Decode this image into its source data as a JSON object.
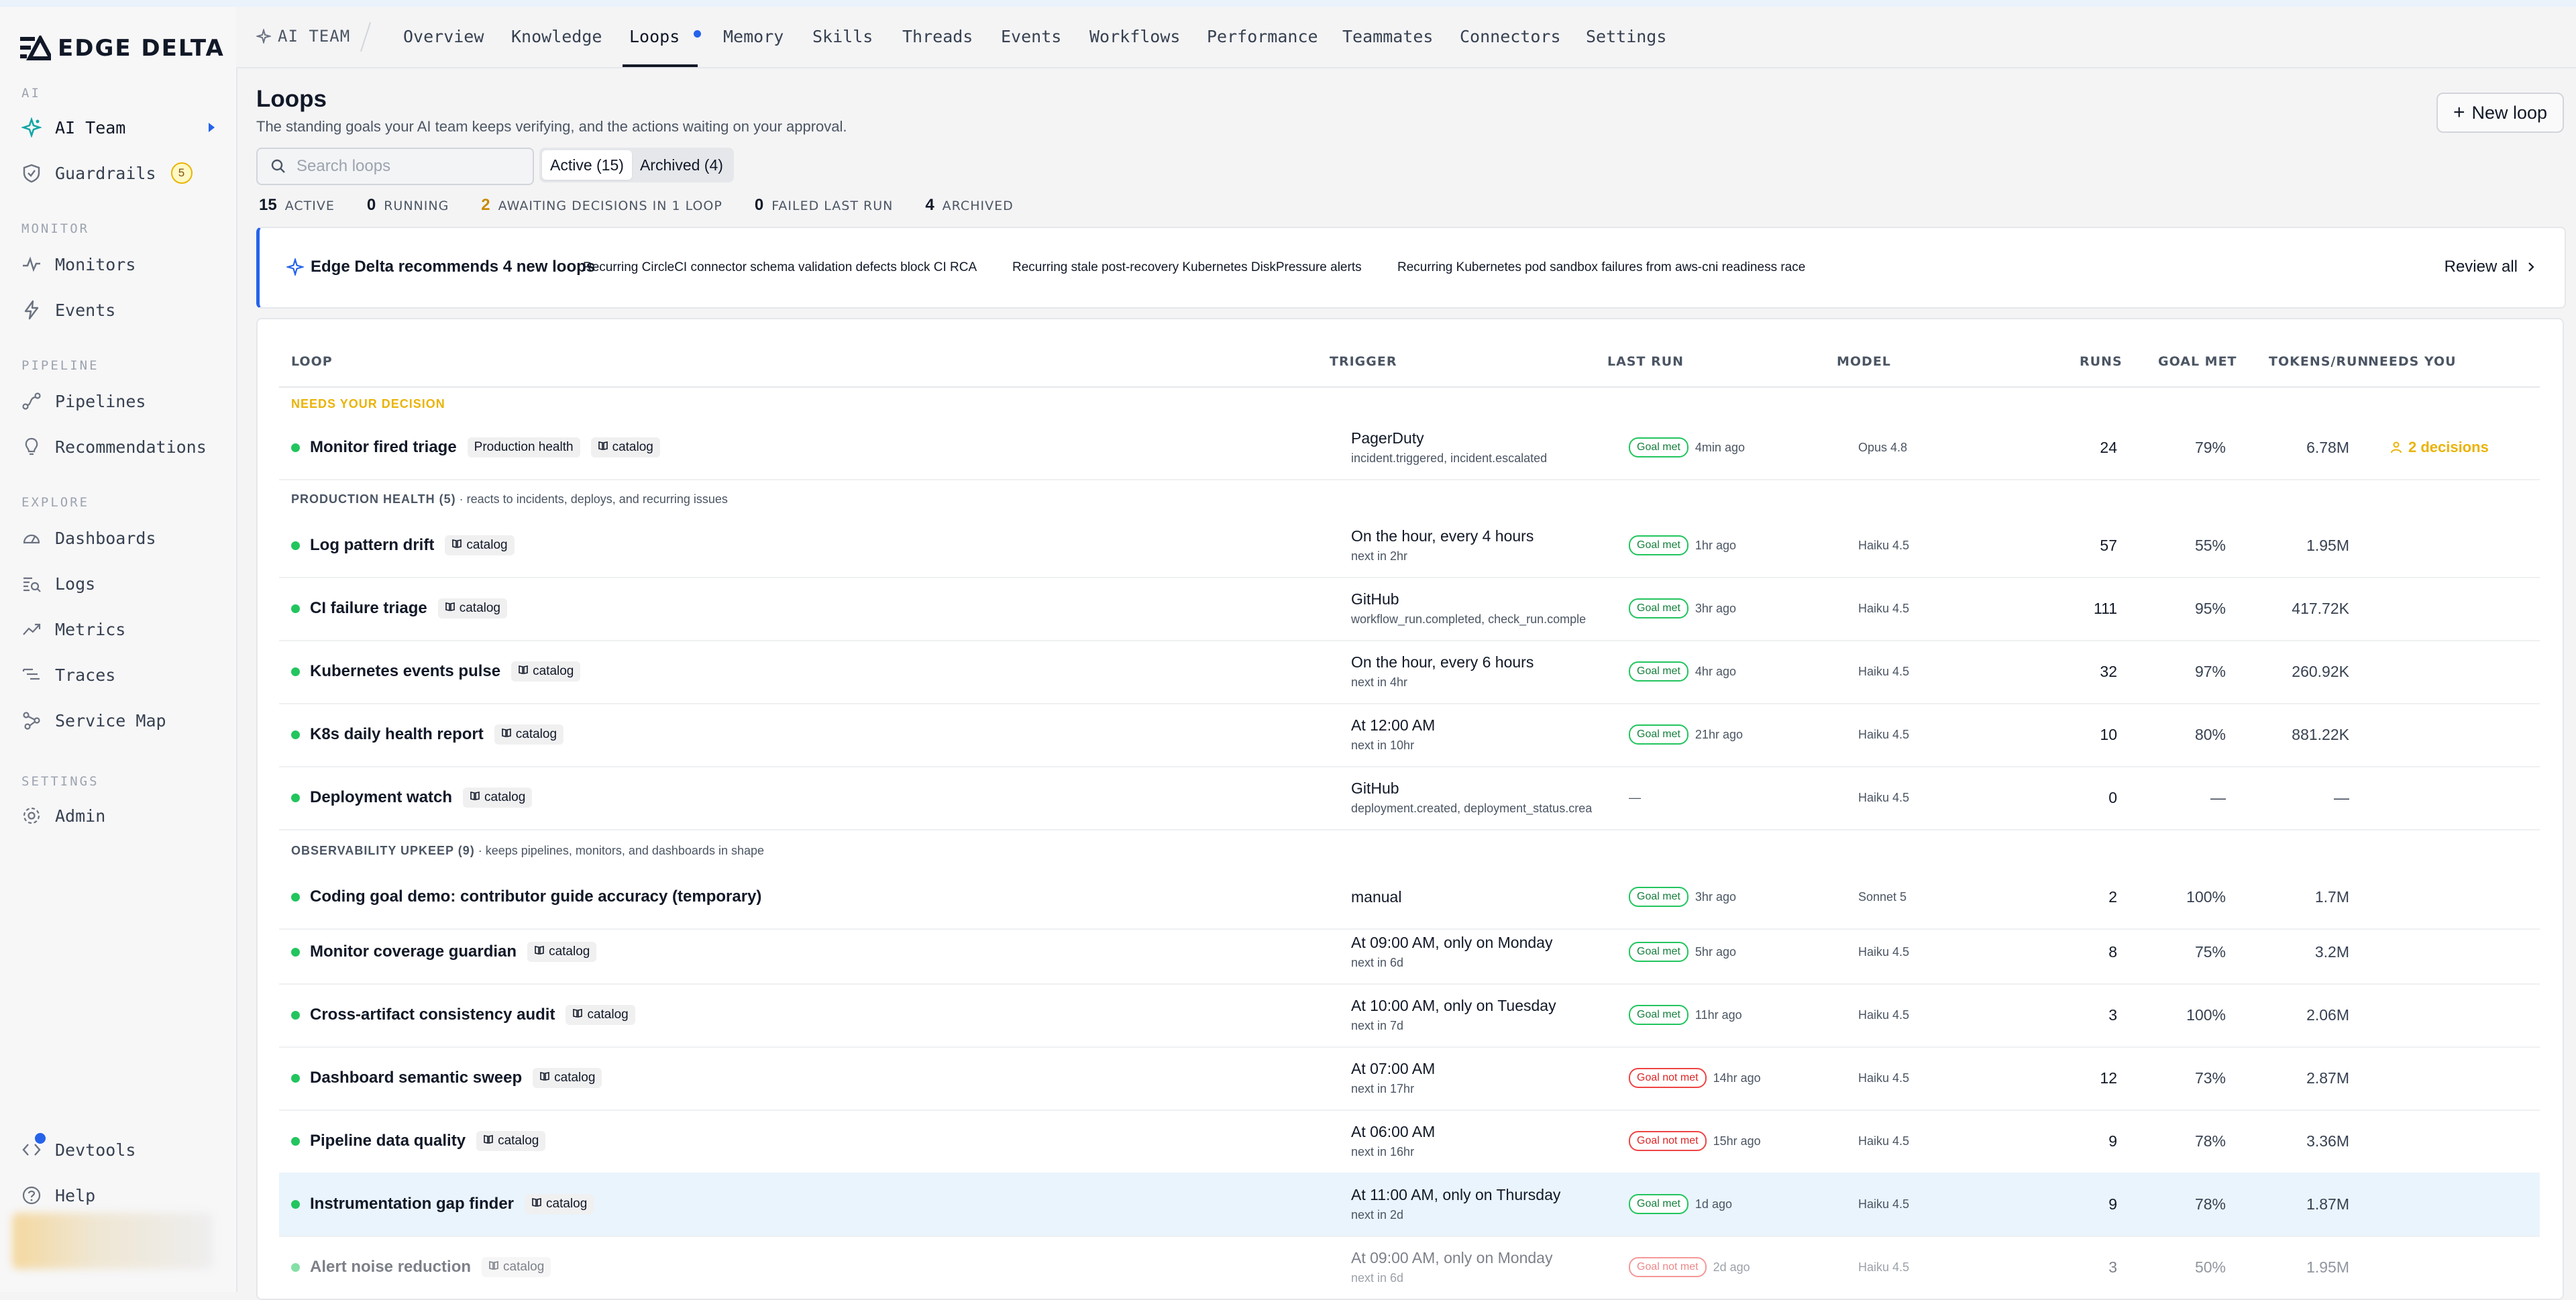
{
  "app": {
    "logo_text": "EDGE DELTA"
  },
  "sidebar": {
    "sections": {
      "ai": "AI",
      "monitor": "MONITOR",
      "pipeline": "PIPELINE",
      "explore": "EXPLORE",
      "settings": "SETTINGS"
    },
    "items": {
      "ai_team": "AI Team",
      "guardrails": "Guardrails",
      "guardrails_badge": "5",
      "monitors": "Monitors",
      "events": "Events",
      "pipelines": "Pipelines",
      "recommendations": "Recommendations",
      "dashboards": "Dashboards",
      "logs": "Logs",
      "metrics": "Metrics",
      "traces": "Traces",
      "service_map": "Service Map",
      "admin": "Admin",
      "devtools": "Devtools",
      "help": "Help"
    }
  },
  "topbar": {
    "breadcrumb": "AI TEAM",
    "tabs": [
      "Overview",
      "Knowledge",
      "Loops",
      "Memory",
      "Skills",
      "Threads",
      "Events",
      "Workflows",
      "Performance",
      "Teammates",
      "Connectors",
      "Settings"
    ],
    "active_tab": "Loops"
  },
  "page": {
    "title": "Loops",
    "subtitle": "The standing goals your AI team keeps verifying, and the actions waiting on your approval.",
    "new_button": "New loop",
    "search_placeholder": "Search loops",
    "filter_active": "Active (15)",
    "filter_archived": "Archived (4)"
  },
  "stats": [
    {
      "value": "15",
      "label": "ACTIVE"
    },
    {
      "value": "0",
      "label": "RUNNING"
    },
    {
      "value": "2",
      "label": "AWAITING DECISIONS IN 1 LOOP"
    },
    {
      "value": "0",
      "label": "FAILED LAST RUN"
    },
    {
      "value": "4",
      "label": "ARCHIVED"
    }
  ],
  "recommendation": {
    "title": "Edge Delta recommends 4 new loops",
    "items": [
      "Recurring CircleCI connector schema validation defects block CI RCA",
      "Recurring stale post-recovery Kubernetes DiskPressure alerts",
      "Recurring Kubernetes pod sandbox failures from aws-cni readiness race"
    ],
    "review_all": "Review all"
  },
  "table": {
    "columns": [
      "LOOP",
      "TRIGGER",
      "LAST RUN",
      "MODEL",
      "RUNS",
      "GOAL MET",
      "TOKENS/RUN",
      "NEEDS YOU"
    ],
    "groups": {
      "needs": "NEEDS YOUR DECISION",
      "prod": "PRODUCTION HEALTH (5)",
      "prod_desc": " · reacts to incidents, deploys, and recurring issues",
      "obs": "OBSERVABILITY UPKEEP (9)",
      "obs_desc": " · keeps pipelines, monitors, and dashboards in shape"
    },
    "rows": [
      {
        "name": "Monitor fired triage",
        "tags": [
          "Production health",
          "catalog"
        ],
        "trigger": "PagerDuty",
        "trigger_sub": "incident.triggered, incident.escalated",
        "pill": "Goal met",
        "ago": "4min ago",
        "model": "Opus 4.8",
        "runs": "24",
        "goal": "79%",
        "tokens": "6.78M",
        "needs": "2 decisions"
      },
      {
        "name": "Log pattern drift",
        "tags": [
          "catalog"
        ],
        "trigger": "On the hour, every 4 hours",
        "trigger_sub": "next in 2hr",
        "pill": "Goal met",
        "ago": "1hr ago",
        "model": "Haiku 4.5",
        "runs": "57",
        "goal": "55%",
        "tokens": "1.95M",
        "needs": ""
      },
      {
        "name": "CI failure triage",
        "tags": [
          "catalog"
        ],
        "trigger": "GitHub",
        "trigger_sub": "workflow_run.completed, check_run.comple",
        "pill": "Goal met",
        "ago": "3hr ago",
        "model": "Haiku 4.5",
        "runs": "111",
        "goal": "95%",
        "tokens": "417.72K",
        "needs": ""
      },
      {
        "name": "Kubernetes events pulse",
        "tags": [
          "catalog"
        ],
        "trigger": "On the hour, every 6 hours",
        "trigger_sub": "next in 4hr",
        "pill": "Goal met",
        "ago": "4hr ago",
        "model": "Haiku 4.5",
        "runs": "32",
        "goal": "97%",
        "tokens": "260.92K",
        "needs": ""
      },
      {
        "name": "K8s daily health report",
        "tags": [
          "catalog"
        ],
        "trigger": "At 12:00 AM",
        "trigger_sub": "next in 10hr",
        "pill": "Goal met",
        "ago": "21hr ago",
        "model": "Haiku 4.5",
        "runs": "10",
        "goal": "80%",
        "tokens": "881.22K",
        "needs": ""
      },
      {
        "name": "Deployment watch",
        "tags": [
          "catalog"
        ],
        "trigger": "GitHub",
        "trigger_sub": "deployment.created, deployment_status.crea",
        "pill": "",
        "ago": "—",
        "model": "Haiku 4.5",
        "runs": "0",
        "goal": "—",
        "tokens": "—",
        "needs": ""
      },
      {
        "name": "Coding goal demo: contributor guide accuracy (temporary)",
        "tags": [],
        "trigger": "manual",
        "trigger_sub": "",
        "pill": "Goal met",
        "ago": "3hr ago",
        "model": "Sonnet 5",
        "runs": "2",
        "goal": "100%",
        "tokens": "1.7M",
        "needs": ""
      },
      {
        "name": "Monitor coverage guardian",
        "tags": [
          "catalog"
        ],
        "trigger": "At 09:00 AM, only on Monday",
        "trigger_sub": "next in 6d",
        "pill": "Goal met",
        "ago": "5hr ago",
        "model": "Haiku 4.5",
        "runs": "8",
        "goal": "75%",
        "tokens": "3.2M",
        "needs": ""
      },
      {
        "name": "Cross-artifact consistency audit",
        "tags": [
          "catalog"
        ],
        "trigger": "At 10:00 AM, only on Tuesday",
        "trigger_sub": "next in 7d",
        "pill": "Goal met",
        "ago": "11hr ago",
        "model": "Haiku 4.5",
        "runs": "3",
        "goal": "100%",
        "tokens": "2.06M",
        "needs": ""
      },
      {
        "name": "Dashboard semantic sweep",
        "tags": [
          "catalog"
        ],
        "trigger": "At 07:00 AM",
        "trigger_sub": "next in 17hr",
        "pill": "Goal not met",
        "ago": "14hr ago",
        "model": "Haiku 4.5",
        "runs": "12",
        "goal": "73%",
        "tokens": "2.87M",
        "needs": ""
      },
      {
        "name": "Pipeline data quality",
        "tags": [
          "catalog"
        ],
        "trigger": "At 06:00 AM",
        "trigger_sub": "next in 16hr",
        "pill": "Goal not met",
        "ago": "15hr ago",
        "model": "Haiku 4.5",
        "runs": "9",
        "goal": "78%",
        "tokens": "3.36M",
        "needs": ""
      },
      {
        "name": "Instrumentation gap finder",
        "tags": [
          "catalog"
        ],
        "trigger": "At 11:00 AM, only on Thursday",
        "trigger_sub": "next in 2d",
        "pill": "Goal met",
        "ago": "1d ago",
        "model": "Haiku 4.5",
        "runs": "9",
        "goal": "78%",
        "tokens": "1.87M",
        "needs": ""
      },
      {
        "name": "Alert noise reduction",
        "tags": [
          "catalog"
        ],
        "trigger": "At 09:00 AM, only on Monday",
        "trigger_sub": "next in 6d",
        "pill": "Goal not met",
        "ago": "2d ago",
        "model": "Haiku 4.5",
        "runs": "3",
        "goal": "50%",
        "tokens": "1.95M",
        "needs": ""
      }
    ]
  },
  "colors": {
    "accent": "#2563eb",
    "warning": "#eab308",
    "ok": "#22c55e",
    "bad": "#ef4444"
  }
}
